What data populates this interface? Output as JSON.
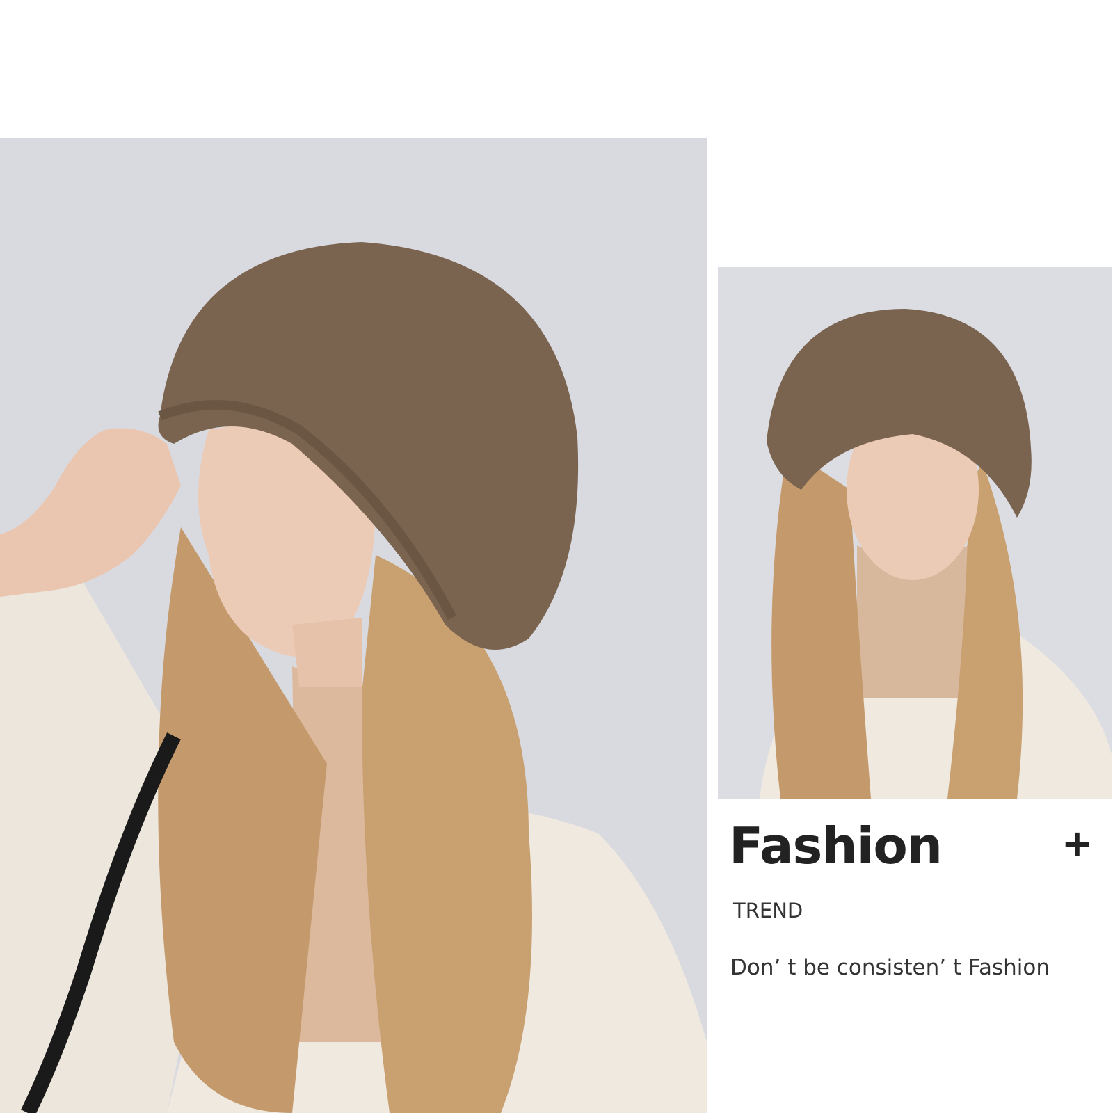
{
  "promo": {
    "headline": "Fashion",
    "plus_symbol": "+",
    "subhead": "TREND",
    "tagline": "Don’ t be consisten’ t Fashion"
  },
  "photos": {
    "large": {
      "subject": "model-side-profile-fur-bucket-hat"
    },
    "small": {
      "subject": "model-front-view-fur-bucket-hat"
    }
  },
  "colors": {
    "hat": "#7a6450",
    "background_gray": "#d9dae0",
    "coat": "#ece6dc",
    "hair": "#c49a6c",
    "skin": "#eccbb6",
    "text": "#222222"
  }
}
